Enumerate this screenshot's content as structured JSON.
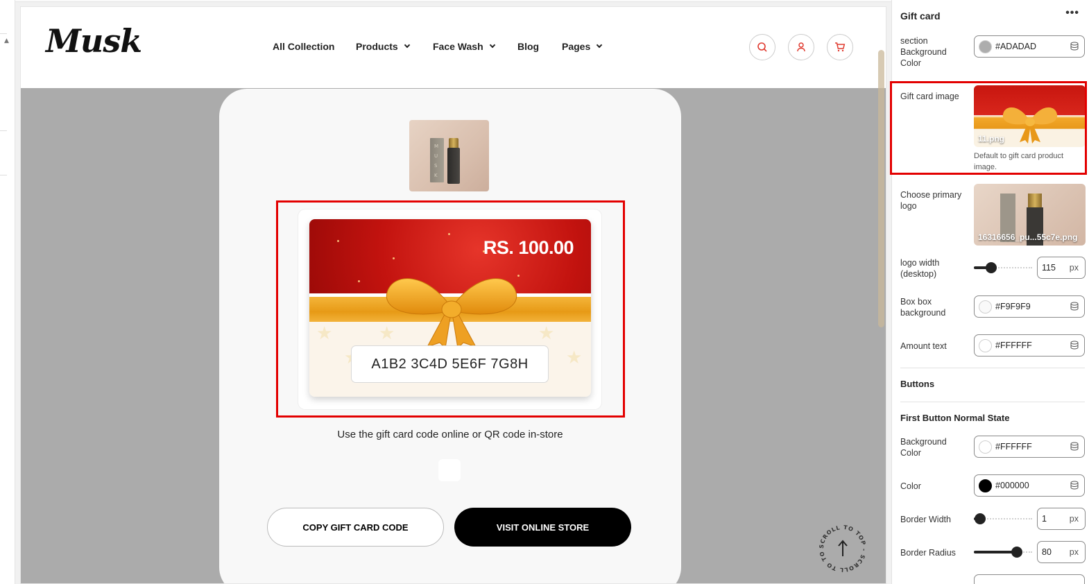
{
  "header": {
    "logo": "Musk",
    "nav": [
      {
        "label": "All Collection",
        "dropdown": false
      },
      {
        "label": "Products",
        "dropdown": true
      },
      {
        "label": "Face Wash",
        "dropdown": true
      },
      {
        "label": "Blog",
        "dropdown": false
      },
      {
        "label": "Pages",
        "dropdown": true
      }
    ],
    "icons": [
      "search-icon",
      "account-icon",
      "cart-icon"
    ],
    "accent": "#e03a2f"
  },
  "gift_card": {
    "amount": "RS. 100.00",
    "code": "A1B2 3C4D 5E6F 7G8H",
    "instructions": "Use the gift card code online or QR code in-store",
    "copy_button": "COPY GIFT CARD CODE",
    "visit_button": "VISIT ONLINE STORE",
    "scroll_to_top": "SCROLL TO TOP - SCROLL TO TOP -"
  },
  "sidebar": {
    "title": "Gift card",
    "section_bg": {
      "label": "section Background Color",
      "value": "#ADADAD",
      "color": "#ADADAD"
    },
    "gift_card_image": {
      "label": "Gift card image",
      "filename": "11.png",
      "note": "Default to gift card product image."
    },
    "primary_logo": {
      "label": "Choose primary logo",
      "filename": "16316656_pu...55c7e.png"
    },
    "logo_width": {
      "label": "logo width (desktop)",
      "value": "115",
      "unit": "px",
      "level": 0.3
    },
    "box_bg": {
      "label": "Box box background",
      "value": "#F9F9F9",
      "color": "#F9F9F9"
    },
    "amount_text": {
      "label": "Amount text",
      "value": "#FFFFFF",
      "color": "#FFFFFF"
    },
    "buttons_heading": "Buttons",
    "first_button_heading": "First Button Normal State",
    "bg_color": {
      "label": "Background Color",
      "value": "#FFFFFF",
      "color": "#FFFFFF"
    },
    "color": {
      "label": "Color",
      "value": "#000000",
      "color": "#000000"
    },
    "border_width": {
      "label": "Border Width",
      "value": "1",
      "unit": "px",
      "level": 0.1
    },
    "border_radius": {
      "label": "Border Radius",
      "value": "80",
      "unit": "px",
      "level": 0.8
    }
  }
}
